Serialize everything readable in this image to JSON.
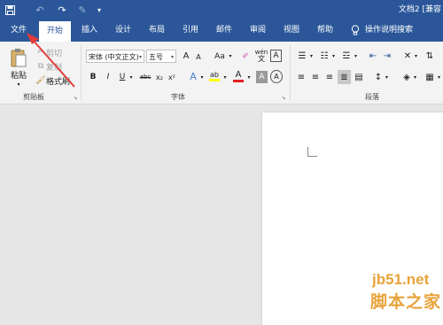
{
  "window": {
    "title": "文档2 [兼容"
  },
  "qat": {
    "save": "save-icon",
    "undo": "undo-icon",
    "redo": "redo-icon",
    "brush": "brush-icon",
    "more": "customize-icon"
  },
  "tabs": [
    {
      "label": "文件"
    },
    {
      "label": "开始"
    },
    {
      "label": "插入"
    },
    {
      "label": "设计"
    },
    {
      "label": "布局"
    },
    {
      "label": "引用"
    },
    {
      "label": "邮件"
    },
    {
      "label": "审阅"
    },
    {
      "label": "视图"
    },
    {
      "label": "帮助"
    }
  ],
  "search": {
    "label": "操作说明搜索",
    "icon": "lightbulb-icon"
  },
  "clipboard": {
    "paste": "粘贴",
    "cut": "剪切",
    "copy": "复制",
    "format_painter": "格式刷",
    "group": "剪贴板"
  },
  "font": {
    "name": "宋体 (中文正文)",
    "size": "五号",
    "grow": "A",
    "shrink": "A",
    "case": "Aa",
    "clear": "clear-format-icon",
    "pinyin": "wén",
    "border": "A",
    "bold": "B",
    "italic": "I",
    "underline": "U",
    "strike": "abc",
    "sub": "x₂",
    "sup": "x²",
    "effects": "A",
    "highlight": "ab",
    "color": "A",
    "shade": "A",
    "circle": "A",
    "group": "字体"
  },
  "paragraph": {
    "group": "段落"
  },
  "colors": {
    "accent": "#2b579a",
    "highlight": "#ffff00",
    "font_color": "#e02020",
    "arrow": "#e23b3b"
  },
  "watermark": {
    "site": "jb51.net",
    "brand": "脚本之家"
  }
}
